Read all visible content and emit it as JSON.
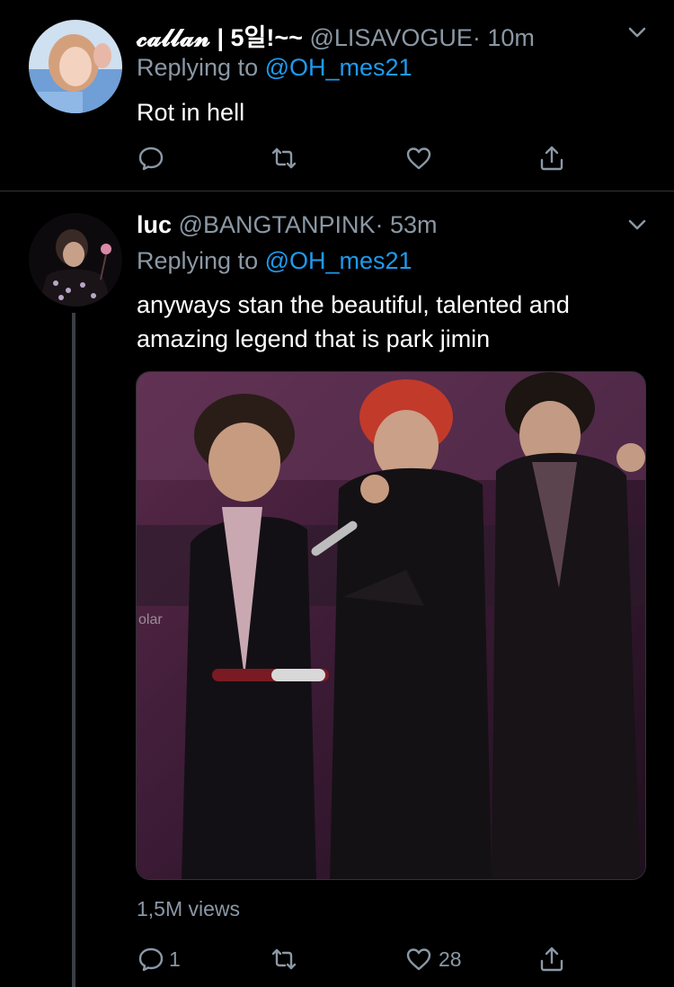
{
  "tweets": [
    {
      "display_name": "𝓬𝓪𝓵𝓵𝓪𝓷 | 5일!~~",
      "handle": "@LISAVOGUE",
      "time": "· 10m",
      "replying_prefix": "Replying to",
      "replying_to": "@OH_mes21",
      "text": "Rot in hell",
      "actions": {
        "reply": "",
        "retweet": "",
        "like": "",
        "share": ""
      }
    },
    {
      "display_name": "luc",
      "handle": "@BANGTANPINK",
      "time": "· 53m",
      "replying_prefix": "Replying to",
      "replying_to": "@OH_mes21",
      "text": "anyways stan the beautiful, talented and amazing legend that is park jimin",
      "media_overlay_text": "olar",
      "views": "1,5M views",
      "actions": {
        "reply": "1",
        "retweet": "",
        "like": "28",
        "share": ""
      }
    }
  ],
  "colors": {
    "accent": "#1d9bf0",
    "muted": "#8b98a5",
    "background": "#000000",
    "divider": "#2f3336"
  }
}
